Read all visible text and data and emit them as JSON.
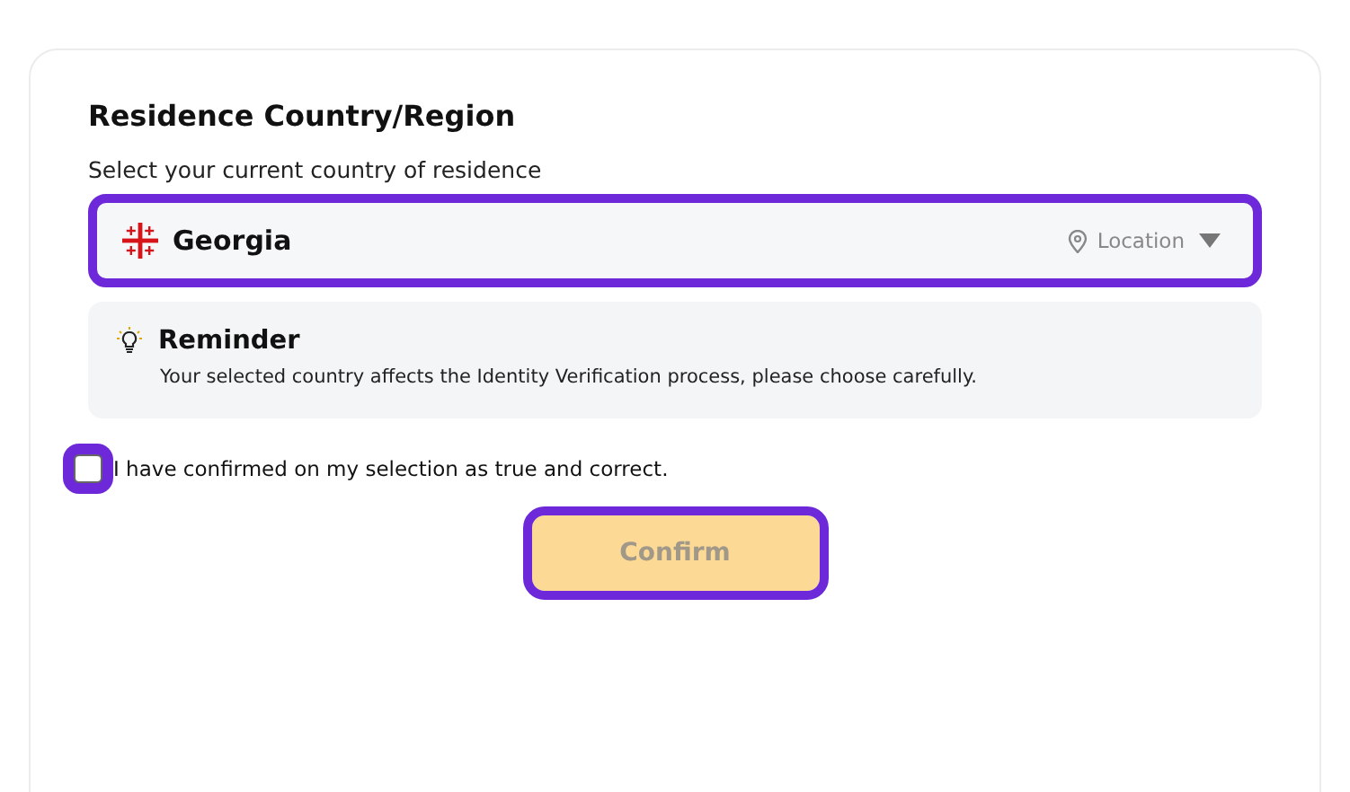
{
  "title": "Residence Country/Region",
  "subtitle": "Select your current country of residence",
  "country_select": {
    "value": "Georgia",
    "location_label": "Location",
    "highlighted": true
  },
  "reminder": {
    "title": "Reminder",
    "text": "Your selected country affects the Identity Verification process, please choose carefully."
  },
  "confirmation": {
    "label": "I have confirmed on my selection as true and correct.",
    "checked": false,
    "highlighted": true
  },
  "confirm_button": {
    "label": "Confirm",
    "disabled": true,
    "highlighted": true
  }
}
